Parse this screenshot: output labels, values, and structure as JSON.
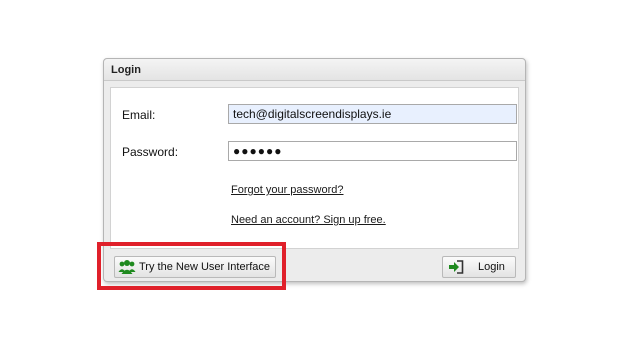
{
  "panel": {
    "title": "Login"
  },
  "form": {
    "email_label": "Email:",
    "email_value": "tech@digitalscreendisplays.ie",
    "password_label": "Password:",
    "password_masked": "●●●●●●",
    "forgot_link": "Forgot your password?",
    "signup_link": "Need an account? Sign up free."
  },
  "footer": {
    "new_ui_label": "Try the New User Interface",
    "login_label": "Login",
    "new_ui_icon": "users-icon",
    "login_icon": "sign-in-icon"
  },
  "colors": {
    "highlight": "#e0202a",
    "icon_green": "#1f8a1f",
    "autofill": "#e8f0fe"
  }
}
